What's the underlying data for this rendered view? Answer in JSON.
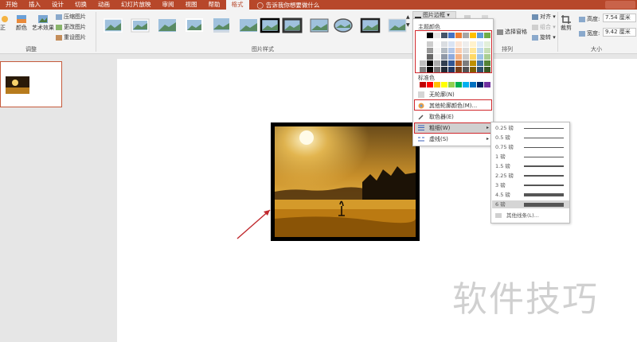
{
  "tabs": [
    "开始",
    "插入",
    "设计",
    "切换",
    "动画",
    "幻灯片放映",
    "审阅",
    "视图",
    "帮助",
    "格式"
  ],
  "active_tab": "格式",
  "tell_me": "告诉我你想要做什么",
  "ribbon": {
    "adjust": {
      "correct": "正",
      "color": "颜色",
      "artistic": "艺术效果",
      "compress": "压缩图片",
      "change": "更改图片",
      "reset": "重设图片",
      "label": "调整"
    },
    "styles_label": "图片样式",
    "arrange": {
      "bring_forward": "对齐",
      "selection_pane": "选择窗格",
      "group": "组合",
      "rotate": "旋转",
      "label": "排列"
    },
    "size": {
      "crop": "裁剪",
      "height_label": "高度:",
      "height_value": "7.54 厘米",
      "width_label": "宽度:",
      "width_value": "9.42 厘米",
      "label": "大小"
    }
  },
  "border_menu": {
    "button": "图片边框",
    "theme_colors": "主题颜色",
    "standard_colors": "标准色",
    "no_outline": "无轮廓(N)",
    "more_colors": "其他轮廓颜色(M)...",
    "eyedropper": "取色器(E)",
    "weight": "粗细(W)",
    "dashes": "虚线(S)",
    "theme_top": [
      "#ffffff",
      "#000000",
      "#e7e6e6",
      "#44546a",
      "#4472c4",
      "#ed7d31",
      "#a5a5a5",
      "#ffc000",
      "#5b9bd5",
      "#70ad47"
    ],
    "standard": [
      "#c00000",
      "#ff0000",
      "#ffc000",
      "#ffff00",
      "#92d050",
      "#00b050",
      "#00b0f0",
      "#0070c0",
      "#002060",
      "#7030a0"
    ]
  },
  "weight_menu": {
    "items": [
      "0.25 磅",
      "0.5 磅",
      "0.75 磅",
      "1 磅",
      "1.5 磅",
      "2.25 磅",
      "3 磅",
      "4.5 磅",
      "6 磅"
    ],
    "selected": "6 磅",
    "more_lines": "其他线条(L)..."
  },
  "watermark": "软件技巧"
}
